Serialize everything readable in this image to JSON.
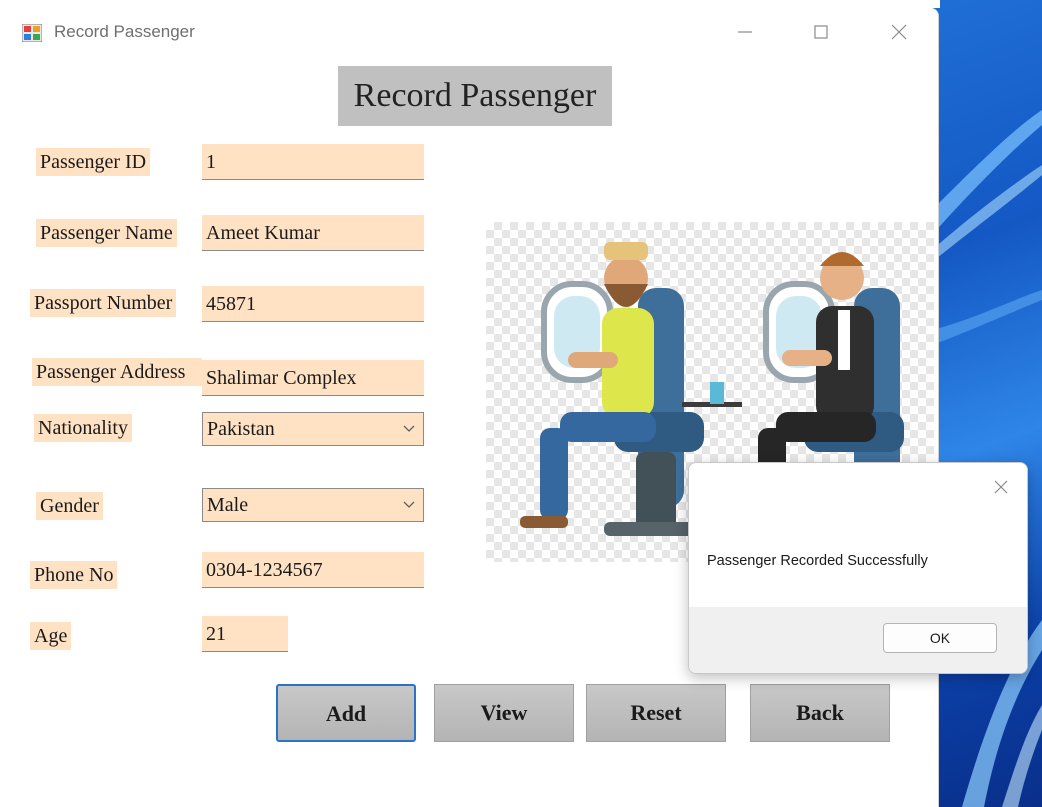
{
  "window": {
    "title": "Record Passenger",
    "app_icon": "winforms-app-icon"
  },
  "form": {
    "heading": "Record Passenger",
    "fields": {
      "passenger_id": {
        "label": "Passenger ID",
        "value": "1"
      },
      "passenger_name": {
        "label": "Passenger Name",
        "value": "Ameet Kumar"
      },
      "passport_number": {
        "label": "Passport Number",
        "value": "45871"
      },
      "passenger_address": {
        "label": "Passenger Address",
        "value": "Shalimar Complex"
      },
      "nationality": {
        "label": "Nationality",
        "value": "Pakistan"
      },
      "gender": {
        "label": "Gender",
        "value": "Male"
      },
      "phone_no": {
        "label": "Phone No",
        "value": "0304-1234567"
      },
      "age": {
        "label": "Age",
        "value": "21"
      }
    },
    "buttons": {
      "add": "Add",
      "view": "View",
      "reset": "Reset",
      "back": "Back"
    }
  },
  "dialog": {
    "message": "Passenger Recorded Successfully",
    "ok": "OK"
  },
  "colors": {
    "field_bg": "#ffe2c4",
    "heading_bg": "#c0c0c0",
    "button_bg": "#bdbdbd",
    "focus_border": "#2a74c8"
  }
}
